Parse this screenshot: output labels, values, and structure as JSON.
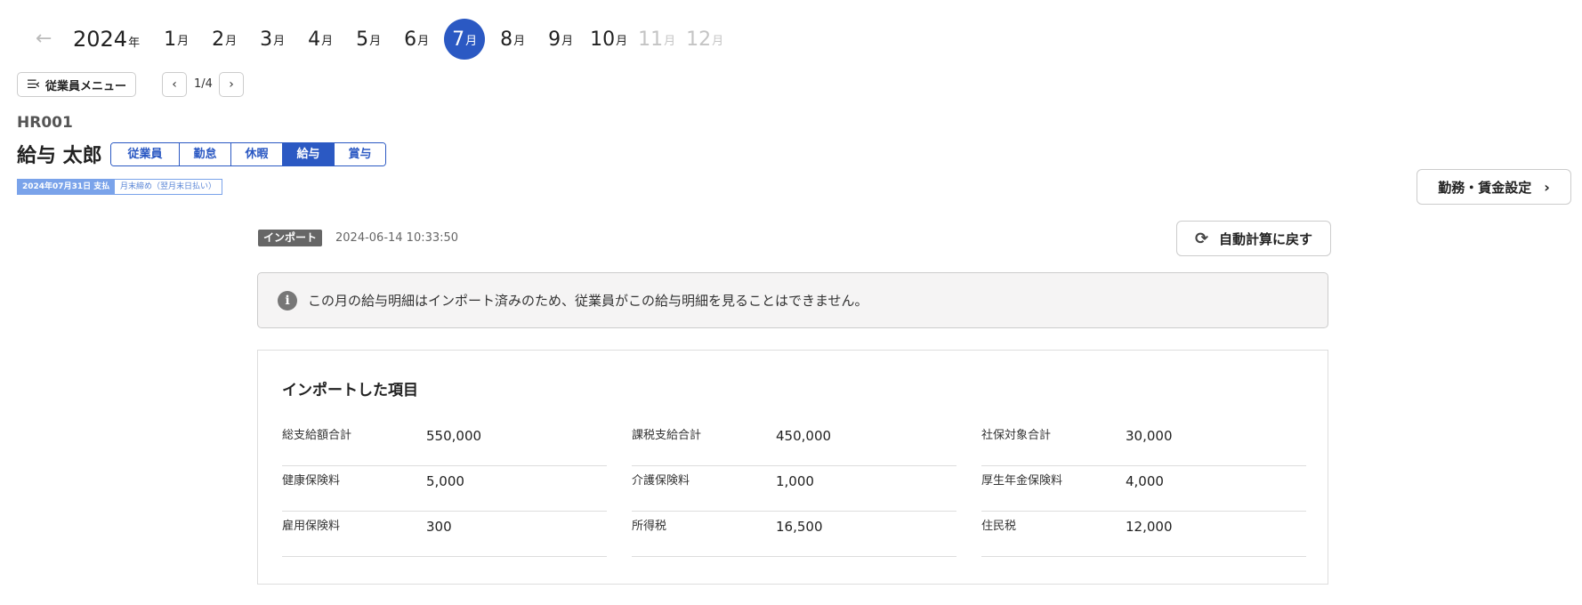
{
  "month_bar": {
    "year": "2024",
    "year_unit": "年",
    "month_unit": "月",
    "months": [
      {
        "num": "1",
        "state": "normal"
      },
      {
        "num": "2",
        "state": "normal"
      },
      {
        "num": "3",
        "state": "normal"
      },
      {
        "num": "4",
        "state": "normal"
      },
      {
        "num": "5",
        "state": "normal"
      },
      {
        "num": "6",
        "state": "normal"
      },
      {
        "num": "7",
        "state": "active"
      },
      {
        "num": "8",
        "state": "normal"
      },
      {
        "num": "9",
        "state": "normal"
      },
      {
        "num": "10",
        "state": "normal"
      },
      {
        "num": "11",
        "state": "disabled"
      },
      {
        "num": "12",
        "state": "disabled"
      }
    ]
  },
  "employee_menu": {
    "label": "従業員メニュー"
  },
  "pager": {
    "text": "1/4"
  },
  "employee": {
    "code": "HR001",
    "name": "給与 太郎"
  },
  "tabs": [
    {
      "label": "従業員",
      "active": false
    },
    {
      "label": "勤怠",
      "active": false
    },
    {
      "label": "休暇",
      "active": false
    },
    {
      "label": "給与",
      "active": true
    },
    {
      "label": "賞与",
      "active": false
    }
  ],
  "badges": {
    "payment": "2024年07月31日 支払",
    "closing": "月末締め（翌月末日払い）"
  },
  "settings_button": {
    "label": "勤務・賃金設定"
  },
  "import_info": {
    "badge": "インポート",
    "timestamp": "2024-06-14 10:33:50"
  },
  "recalc_button": {
    "label": "自動計算に戻す"
  },
  "notice": {
    "message": "この月の給与明細はインポート済みのため、従業員がこの給与明細を見ることはできません。"
  },
  "imported": {
    "title": "インポートした項目",
    "items": [
      {
        "label": "総支給額合計",
        "value": "550,000"
      },
      {
        "label": "課税支給合計",
        "value": "450,000"
      },
      {
        "label": "社保対象合計",
        "value": "30,000"
      },
      {
        "label": "健康保険料",
        "value": "5,000"
      },
      {
        "label": "介護保険料",
        "value": "1,000"
      },
      {
        "label": "厚生年金保険料",
        "value": "4,000"
      },
      {
        "label": "雇用保険料",
        "value": "300"
      },
      {
        "label": "所得税",
        "value": "16,500"
      },
      {
        "label": "住民税",
        "value": "12,000"
      }
    ]
  },
  "colors": {
    "accent": "#2b59c3",
    "badge_light": "#7aa3ea",
    "import_badge": "#666666"
  }
}
